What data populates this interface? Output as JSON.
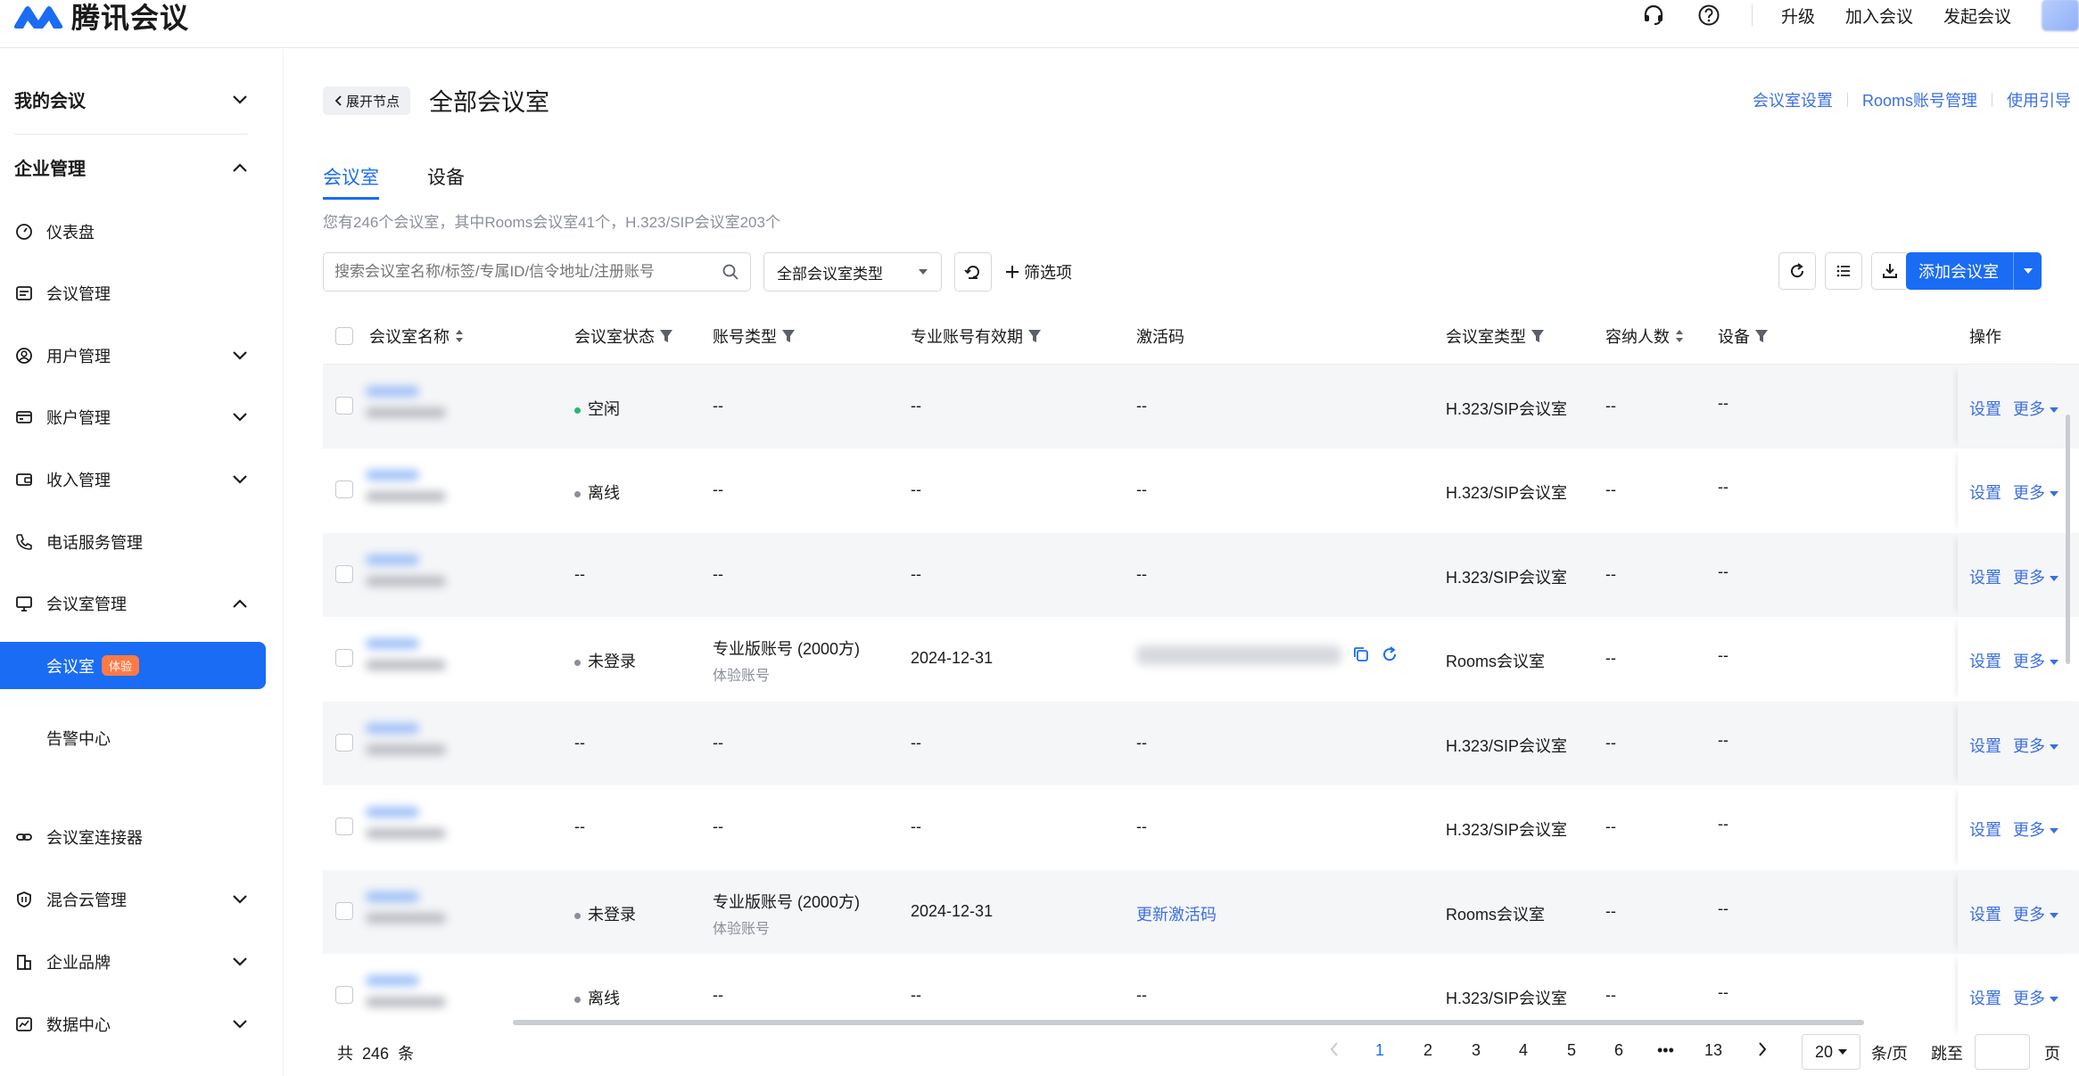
{
  "app": {
    "title": "腾讯会议",
    "brand_color": "#1a6cf5"
  },
  "topbar": {
    "upgrade": "升级",
    "join": "加入会议",
    "start": "发起会议",
    "icons": [
      "headset-icon",
      "help-icon"
    ]
  },
  "sidebar": {
    "my_meetings": "我的会议",
    "enterprise": "企业管理",
    "items": [
      {
        "label": "仪表盘",
        "icon": "dashboard-icon"
      },
      {
        "label": "会议管理",
        "icon": "list-icon"
      },
      {
        "label": "用户管理",
        "icon": "user-icon"
      },
      {
        "label": "账户管理",
        "icon": "card-icon"
      },
      {
        "label": "收入管理",
        "icon": "wallet-icon"
      },
      {
        "label": "电话服务管理",
        "icon": "phone-icon"
      },
      {
        "label": "会议室管理",
        "icon": "monitor-icon"
      },
      {
        "label": "会议室连接器",
        "icon": "link-icon"
      },
      {
        "label": "混合云管理",
        "icon": "shield-icon"
      },
      {
        "label": "企业品牌",
        "icon": "building-icon"
      },
      {
        "label": "数据中心",
        "icon": "chart-icon"
      }
    ],
    "sub_active": "会议室",
    "sub_active_badge": "体验",
    "sub_alarm": "告警中心"
  },
  "header": {
    "expand": "展开节点",
    "title": "全部会议室",
    "links": [
      "会议室设置",
      "Rooms账号管理",
      "使用引导"
    ]
  },
  "tabs": [
    "会议室",
    "设备"
  ],
  "summary": "您有246个会议室，其中Rooms会议室41个，H.323/SIP会议室203个",
  "toolbar": {
    "search_placeholder": "搜索会议室名称/标签/专属ID/信令地址/注册账号",
    "type_select": "全部会议室类型",
    "filter": "筛选项",
    "add": "添加会议室"
  },
  "table": {
    "columns": [
      "会议室名称",
      "会议室状态",
      "账号类型",
      "专业账号有效期",
      "激活码",
      "会议室类型",
      "容纳人数",
      "设备",
      "操作"
    ],
    "rows": [
      {
        "status": "空闲",
        "status_color": "#2bb673",
        "account": "--",
        "account_sub": "",
        "expiry": "--",
        "code": "--",
        "type": "H.323/SIP会议室",
        "capacity": "--",
        "device": "--"
      },
      {
        "status": "离线",
        "status_color": "#8a8f99",
        "account": "--",
        "account_sub": "",
        "expiry": "--",
        "code": "--",
        "type": "H.323/SIP会议室",
        "capacity": "--",
        "device": "--"
      },
      {
        "status": "--",
        "status_color": "",
        "account": "--",
        "account_sub": "",
        "expiry": "--",
        "code": "--",
        "type": "H.323/SIP会议室",
        "capacity": "--",
        "device": "--"
      },
      {
        "status": "未登录",
        "status_color": "#8a8f99",
        "account": "专业版账号 (2000方)",
        "account_sub": "体验账号",
        "expiry": "2024-12-31",
        "code": "",
        "type": "Rooms会议室",
        "capacity": "--",
        "device": "--"
      },
      {
        "status": "--",
        "status_color": "",
        "account": "--",
        "account_sub": "",
        "expiry": "--",
        "code": "--",
        "type": "H.323/SIP会议室",
        "capacity": "--",
        "device": "--"
      },
      {
        "status": "--",
        "status_color": "",
        "account": "--",
        "account_sub": "",
        "expiry": "--",
        "code": "--",
        "type": "H.323/SIP会议室",
        "capacity": "--",
        "device": "--"
      },
      {
        "status": "未登录",
        "status_color": "#8a8f99",
        "account": "专业版账号 (2000方)",
        "account_sub": "体验账号",
        "expiry": "2024-12-31",
        "code": "更新激活码",
        "type": "Rooms会议室",
        "capacity": "--",
        "device": "--"
      },
      {
        "status": "离线",
        "status_color": "#8a8f99",
        "account": "--",
        "account_sub": "",
        "expiry": "--",
        "code": "--",
        "type": "H.323/SIP会议室",
        "capacity": "--",
        "device": "--"
      }
    ],
    "op_set": "设置",
    "op_more": "更多"
  },
  "pager": {
    "total_prefix": "共",
    "total": "246",
    "total_suffix": "条",
    "pages": [
      "1",
      "2",
      "3",
      "4",
      "5",
      "6",
      "•••",
      "13"
    ],
    "current": "1",
    "size": "20",
    "size_unit": "条/页",
    "jump_prefix": "跳至",
    "jump_suffix": "页"
  }
}
